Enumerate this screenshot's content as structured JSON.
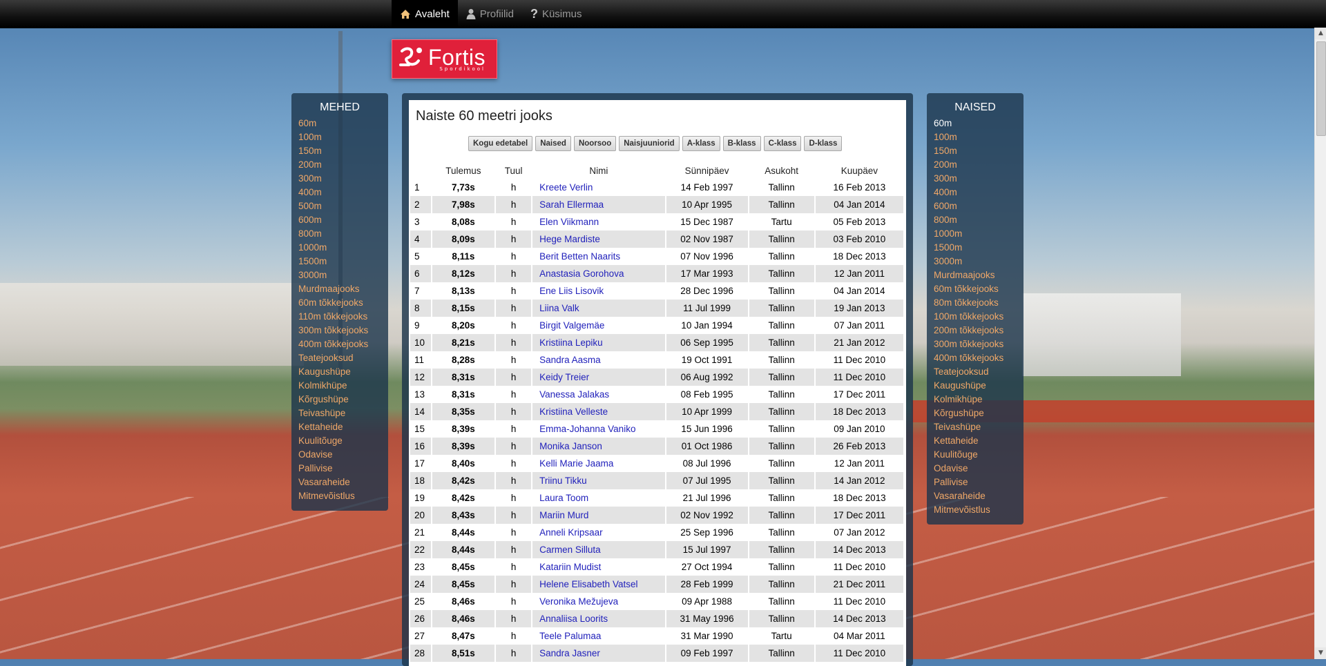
{
  "nav": {
    "items": [
      {
        "label": "Avaleht",
        "icon": "home-icon",
        "active": true
      },
      {
        "label": "Profiilid",
        "icon": "user-icon",
        "active": false
      },
      {
        "label": "Küsimus",
        "icon": "question-icon",
        "active": false
      }
    ]
  },
  "logo": {
    "name": "Fortis",
    "sub": "Spordikool"
  },
  "men": {
    "title": "MEHED",
    "items": [
      "60m",
      "100m",
      "150m",
      "200m",
      "300m",
      "400m",
      "500m",
      "600m",
      "800m",
      "1000m",
      "1500m",
      "3000m",
      "Murdmaajooks",
      "60m tõkkejooks",
      "110m tõkkejooks",
      "300m tõkkejooks",
      "400m tõkkejooks",
      "Teatejooksud",
      "Kaugushüpe",
      "Kolmikhüpe",
      "Kõrgushüpe",
      "Teivashüpe",
      "Kettaheide",
      "Kuulitõuge",
      "Odavise",
      "Pallivise",
      "Vasaraheide",
      "Mitmevõistlus"
    ]
  },
  "women": {
    "title": "NAISED",
    "items": [
      "60m",
      "100m",
      "150m",
      "200m",
      "300m",
      "400m",
      "600m",
      "800m",
      "1000m",
      "1500m",
      "3000m",
      "Murdmaajooks",
      "60m tõkkejooks",
      "80m tõkkejooks",
      "100m tõkkejooks",
      "200m tõkkejooks",
      "300m tõkkejooks",
      "400m tõkkejooks",
      "Teatejooksud",
      "Kaugushüpe",
      "Kolmikhüpe",
      "Kõrgushüpe",
      "Teivashüpe",
      "Kettaheide",
      "Kuulitõuge",
      "Odavise",
      "Pallivise",
      "Vasaraheide",
      "Mitmevõistlus"
    ],
    "current": 0
  },
  "main": {
    "title": "Naiste 60 meetri jooks",
    "filters": [
      "Kogu edetabel",
      "Naised",
      "Noorsoo",
      "Naisjuuniorid",
      "A-klass",
      "B-klass",
      "C-klass",
      "D-klass"
    ],
    "columns": {
      "result": "Tulemus",
      "wind": "Tuul",
      "name": "Nimi",
      "born": "Sünnipäev",
      "location": "Asukoht",
      "date": "Kuupäev"
    },
    "rows": [
      [
        "1",
        "7,73s",
        "h",
        "Kreete Verlin",
        "14 Feb 1997",
        "Tallinn",
        "16 Feb 2013"
      ],
      [
        "2",
        "7,98s",
        "h",
        "Sarah Ellermaa",
        "10 Apr 1995",
        "Tallinn",
        "04 Jan 2014"
      ],
      [
        "3",
        "8,08s",
        "h",
        "Elen Viikmann",
        "15 Dec 1987",
        "Tartu",
        "05 Feb 2013"
      ],
      [
        "4",
        "8,09s",
        "h",
        "Hege Mardiste",
        "02 Nov 1987",
        "Tallinn",
        "03 Feb 2010"
      ],
      [
        "5",
        "8,11s",
        "h",
        "Berit Betten Naarits",
        "07 Nov 1996",
        "Tallinn",
        "18 Dec 2013"
      ],
      [
        "6",
        "8,12s",
        "h",
        "Anastasia Gorohova",
        "17 Mar 1993",
        "Tallinn",
        "12 Jan 2011"
      ],
      [
        "7",
        "8,13s",
        "h",
        "Ene Liis Lisovik",
        "28 Dec 1996",
        "Tallinn",
        "04 Jan 2014"
      ],
      [
        "8",
        "8,15s",
        "h",
        "Liina Valk",
        "11 Jul 1999",
        "Tallinn",
        "19 Jan 2013"
      ],
      [
        "9",
        "8,20s",
        "h",
        "Birgit Valgemäe",
        "10 Jan 1994",
        "Tallinn",
        "07 Jan 2011"
      ],
      [
        "10",
        "8,21s",
        "h",
        "Kristiina Lepiku",
        "06 Sep 1995",
        "Tallinn",
        "21 Jan 2012"
      ],
      [
        "11",
        "8,28s",
        "h",
        "Sandra Aasma",
        "19 Oct 1991",
        "Tallinn",
        "11 Dec 2010"
      ],
      [
        "12",
        "8,31s",
        "h",
        "Keidy Treier",
        "06 Aug 1992",
        "Tallinn",
        "11 Dec 2010"
      ],
      [
        "13",
        "8,31s",
        "h",
        "Vanessa Jalakas",
        "08 Feb 1995",
        "Tallinn",
        "17 Dec 2011"
      ],
      [
        "14",
        "8,35s",
        "h",
        "Kristiina Velleste",
        "10 Apr 1999",
        "Tallinn",
        "18 Dec 2013"
      ],
      [
        "15",
        "8,39s",
        "h",
        "Emma-Johanna Vaniko",
        "15 Jun 1996",
        "Tallinn",
        "09 Jan 2010"
      ],
      [
        "16",
        "8,39s",
        "h",
        "Monika Janson",
        "01 Oct 1986",
        "Tallinn",
        "26 Feb 2013"
      ],
      [
        "17",
        "8,40s",
        "h",
        "Kelli Marie Jaama",
        "08 Jul 1996",
        "Tallinn",
        "12 Jan 2011"
      ],
      [
        "18",
        "8,42s",
        "h",
        "Triinu Tikku",
        "07 Jul 1995",
        "Tallinn",
        "14 Jan 2012"
      ],
      [
        "19",
        "8,42s",
        "h",
        "Laura Toom",
        "21 Jul 1996",
        "Tallinn",
        "18 Dec 2013"
      ],
      [
        "20",
        "8,43s",
        "h",
        "Mariin Murd",
        "02 Nov 1992",
        "Tallinn",
        "17 Dec 2011"
      ],
      [
        "21",
        "8,44s",
        "h",
        "Anneli Kripsaar",
        "25 Sep 1996",
        "Tallinn",
        "07 Jan 2012"
      ],
      [
        "22",
        "8,44s",
        "h",
        "Carmen Silluta",
        "15 Jul 1997",
        "Tallinn",
        "14 Dec 2013"
      ],
      [
        "23",
        "8,45s",
        "h",
        "Katariin Mudist",
        "27 Oct 1994",
        "Tallinn",
        "11 Dec 2010"
      ],
      [
        "24",
        "8,45s",
        "h",
        "Helene Elisabeth Vatsel",
        "28 Feb 1999",
        "Tallinn",
        "21 Dec 2011"
      ],
      [
        "25",
        "8,46s",
        "h",
        "Veronika Mežujeva",
        "09 Apr 1988",
        "Tallinn",
        "11 Dec 2010"
      ],
      [
        "26",
        "8,46s",
        "h",
        "Annaliisa Loorits",
        "31 May 1996",
        "Tallinn",
        "14 Dec 2013"
      ],
      [
        "27",
        "8,47s",
        "h",
        "Teele Palumaa",
        "31 Mar 1990",
        "Tartu",
        "04 Mar 2011"
      ],
      [
        "28",
        "8,51s",
        "h",
        "Sandra Jasner",
        "09 Feb 1997",
        "Tallinn",
        "11 Dec 2010"
      ]
    ]
  },
  "colors": {
    "nav_bg": "#000000",
    "logo_red": "#e0203a",
    "panel": "#1c344b",
    "link": "#2222bb",
    "side_link": "#f0a868"
  }
}
